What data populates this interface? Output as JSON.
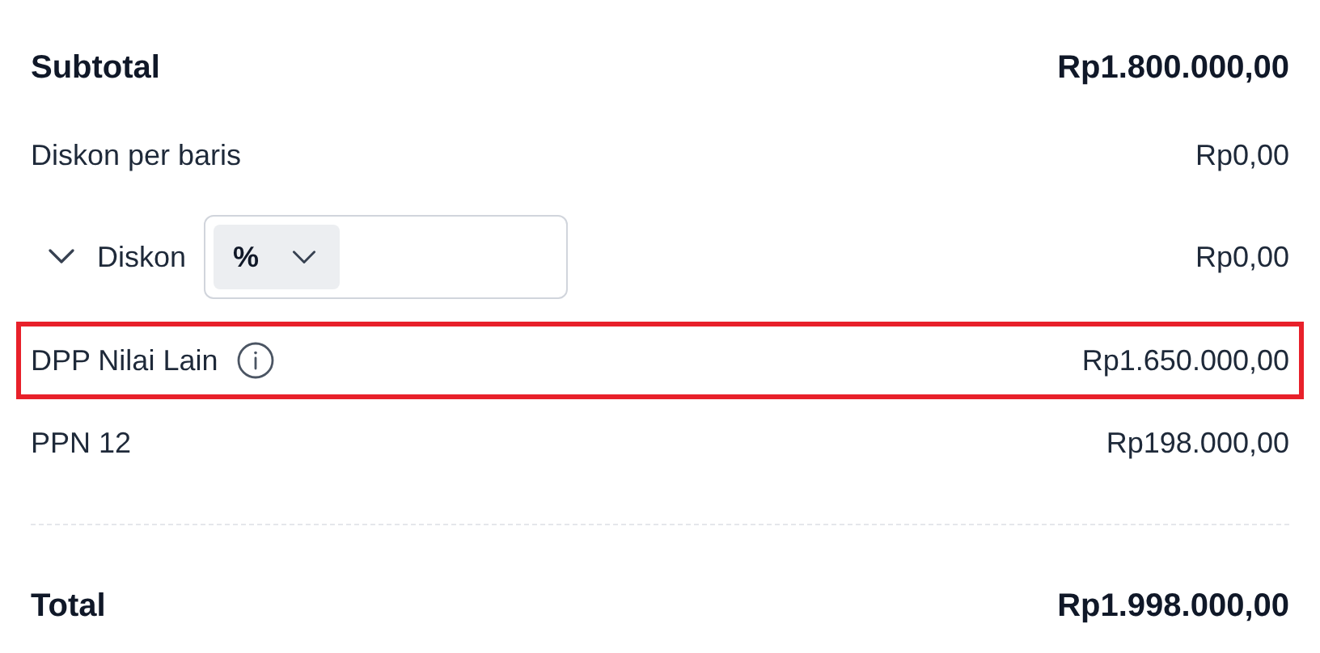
{
  "summary": {
    "rows": [
      {
        "kind": "total",
        "label": "Subtotal",
        "value": "Rp1.800.000,00",
        "highlighted": false
      },
      {
        "kind": "plain",
        "label": "Diskon per baris",
        "value": "Rp0,00",
        "highlighted": false
      },
      {
        "kind": "discount",
        "label": "Diskon",
        "value": "Rp0,00",
        "expanded": false,
        "unit": "%",
        "highlighted": false
      },
      {
        "kind": "info",
        "label": "DPP Nilai Lain",
        "value": "Rp1.650.000,00",
        "highlighted": true
      },
      {
        "kind": "plain",
        "label": "PPN 12",
        "value": "Rp198.000,00",
        "highlighted": false
      },
      {
        "kind": "divider"
      },
      {
        "kind": "total",
        "label": "Total",
        "value": "Rp1.998.000,00",
        "highlighted": false
      }
    ]
  }
}
